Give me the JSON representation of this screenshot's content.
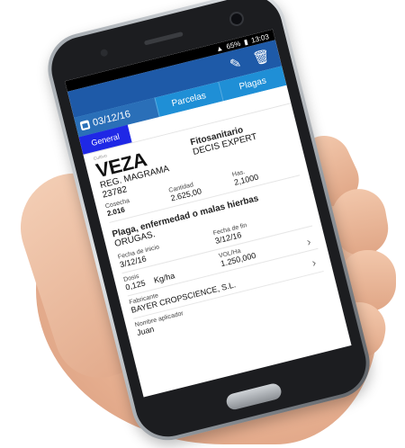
{
  "status": {
    "battery": "65%",
    "time": "13:03"
  },
  "appbar": {
    "edit_icon": "pencil-icon",
    "delete_icon": "trash-icon"
  },
  "tabs": {
    "date": "03/12/16",
    "parcelas": "Parcelas",
    "plagas": "Plagas"
  },
  "subtabs": {
    "general": "General"
  },
  "record": {
    "small_label": "Cultivo",
    "crop": "VEZA",
    "reg_label": "REG. MAGRAMA",
    "reg_value": "23782",
    "fito_label": "Fitosanitario",
    "fito_value": "DECIS EXPERT",
    "cosecha_label": "Cosecha",
    "cosecha_value": "2.016",
    "cantidad_label": "Cantidad",
    "cantidad_value": "2.625,00",
    "has_label": "Has.",
    "has_value": "2,1000",
    "plaga_title": "Plaga, enfermedad o malas hierbas",
    "plaga_value": "ORUGAS.",
    "fecha_inicio_label": "Fecha de inicio",
    "fecha_inicio_value": "3/12/16",
    "fecha_fin_label": "Fecha de fin",
    "fecha_fin_value": "3/12/16",
    "dosis_label": "Dosis",
    "dosis_value": "0,125",
    "dosis_unit": "Kg/ha",
    "vol_label": "VOL/Ha",
    "vol_value": "1.250,000",
    "fabricante_label": "Fabricante",
    "fabricante_value": "BAYER CROPSCIENCE, S.L.",
    "aplicador_label": "Nombre aplicador",
    "aplicador_value": "Juan"
  }
}
